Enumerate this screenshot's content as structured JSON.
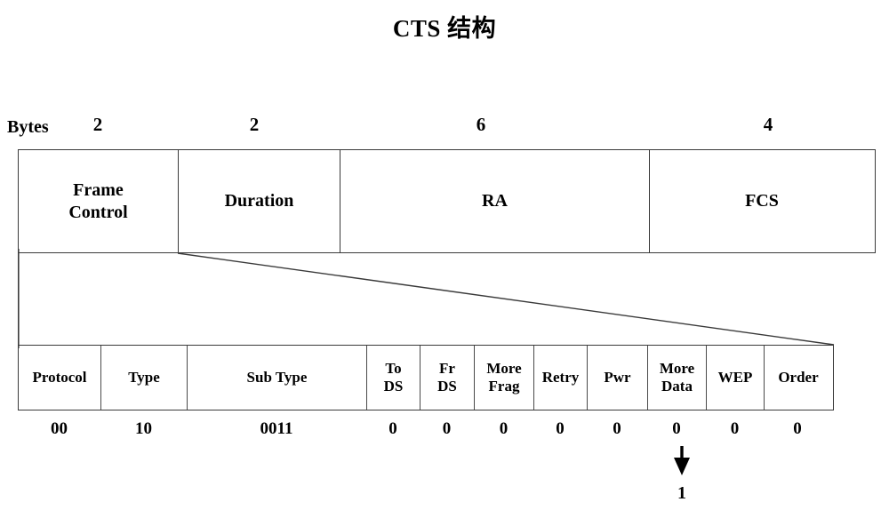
{
  "title": "CTS 结构",
  "bytes_legend": {
    "label": "Bytes",
    "counts": [
      "2",
      "2",
      "6",
      "4"
    ]
  },
  "frame_fields": [
    {
      "label": "Frame\nControl",
      "bytes": "2"
    },
    {
      "label": "Duration",
      "bytes": "2"
    },
    {
      "label": "RA",
      "bytes": "6"
    },
    {
      "label": "FCS",
      "bytes": "4"
    }
  ],
  "frame_control_subfields": [
    {
      "label": "Protocol",
      "value": "00"
    },
    {
      "label": "Type",
      "value": "10"
    },
    {
      "label": "Sub Type",
      "value": "0011"
    },
    {
      "label": "To\nDS",
      "value": "0"
    },
    {
      "label": "Fr\nDS",
      "value": "0"
    },
    {
      "label": "More\nFrag",
      "value": "0"
    },
    {
      "label": "Retry",
      "value": "0"
    },
    {
      "label": "Pwr",
      "value": "0"
    },
    {
      "label": "More\nData",
      "value": "0"
    },
    {
      "label": "WEP",
      "value": "0"
    },
    {
      "label": "Order",
      "value": "0"
    }
  ],
  "annotation": {
    "icon": "down-arrow-icon",
    "target_field": "More\nData",
    "new_value": "1"
  },
  "colors": {
    "background": "#ffffff",
    "text": "#000000",
    "border": "#3a3a3a",
    "inner_border": "#4a4a4a"
  }
}
